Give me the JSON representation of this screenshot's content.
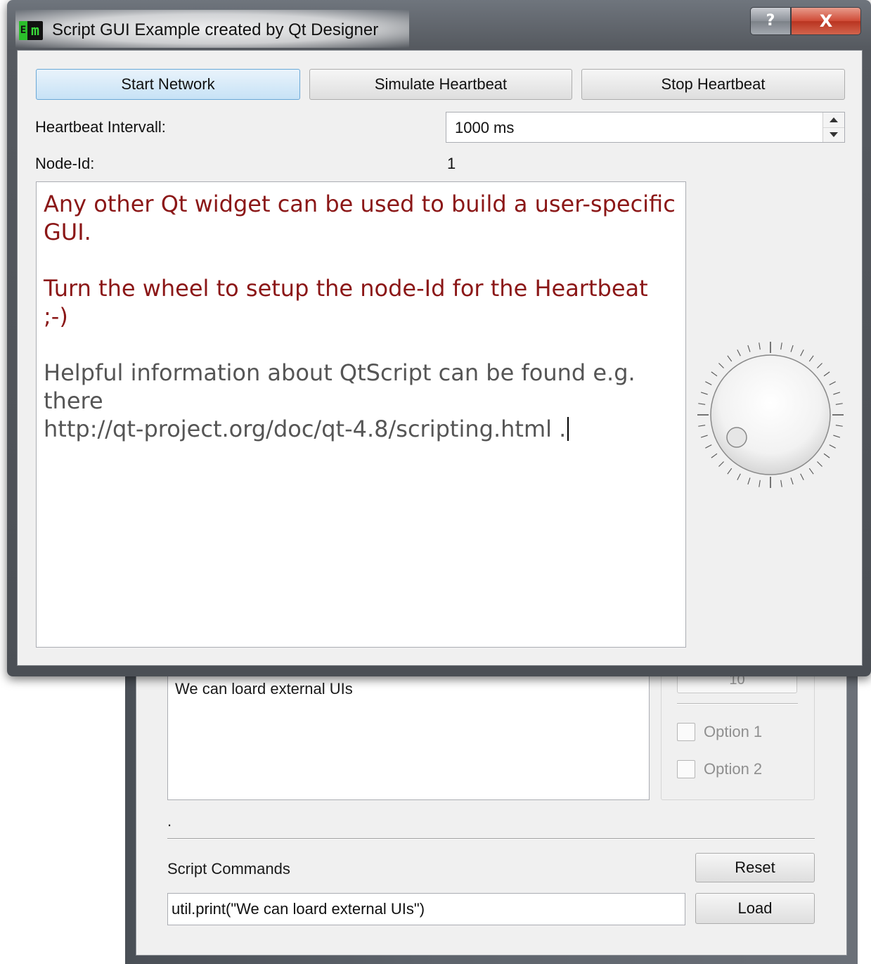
{
  "back_window": {
    "output_text": "We can loard external UIs",
    "spin_value": "10",
    "options": [
      {
        "label": "Option 1",
        "checked": false
      },
      {
        "label": "Option 2",
        "checked": false
      }
    ],
    "status_label": ".",
    "script_commands_label": "Script Commands",
    "reset_label": "Reset",
    "load_label": "Load",
    "command_value": "util.print(\"We can loard external UIs\")"
  },
  "front_window": {
    "app_icon": {
      "text_e": "E",
      "text_m": "m"
    },
    "title": "Script GUI Example created by Qt Designer",
    "help_icon": "?",
    "close_icon": "X",
    "buttons": {
      "start_network": "Start Network",
      "simulate_heartbeat": "Simulate Heartbeat",
      "stop_heartbeat": "Stop Heartbeat"
    },
    "heartbeat_label": "Heartbeat Intervall:",
    "heartbeat_value": "1000 ms",
    "node_id_label": "Node-Id:",
    "node_id_value": "1",
    "text": {
      "line1": "Any other Qt widget can be used to build a user-specific GUI.",
      "line2": "Turn the wheel to setup the node-Id for the Heartbeat ;-)",
      "line3": "Helpful information about QtScript can be found e.g. there",
      "line4": "http://qt-project.org/doc/qt-4.8/scripting.html ."
    },
    "dial": {
      "min": 1,
      "max": 127,
      "value": 1
    }
  },
  "colors": {
    "text_red": "#8b1717",
    "text_gray": "#555555",
    "close_red": "#c8402c",
    "default_button_blue": "#6aa8d7"
  }
}
